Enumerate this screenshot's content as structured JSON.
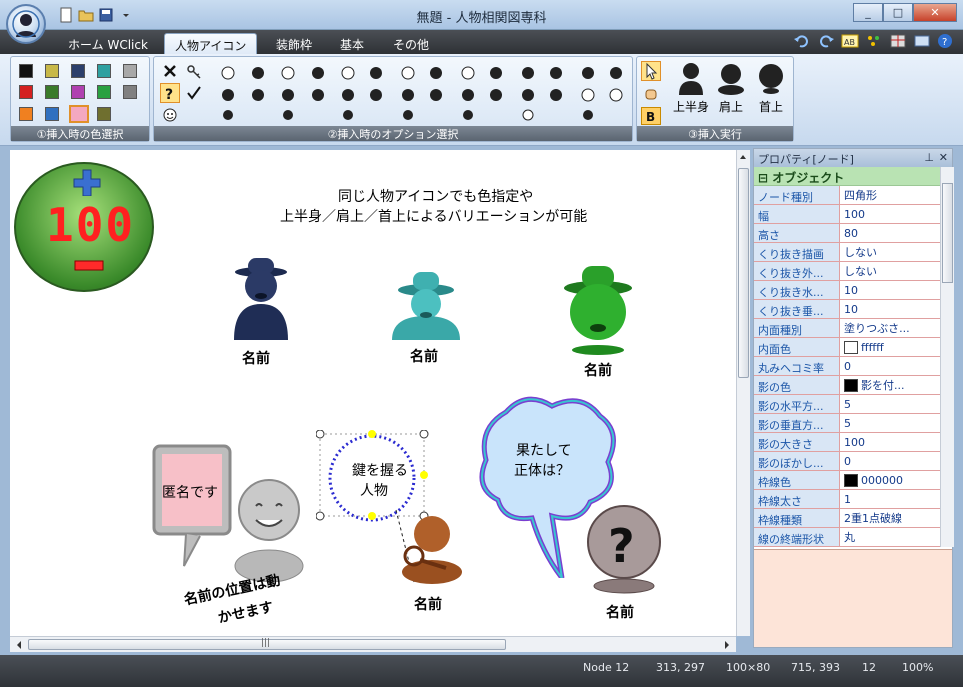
{
  "window": {
    "title": "無題 - 人物相関図専科",
    "min": "_",
    "max": "□",
    "close": "✕"
  },
  "tabs": [
    {
      "label": "ホーム WClick"
    },
    {
      "label": "人物アイコン"
    },
    {
      "label": "装飾枠"
    },
    {
      "label": "基本"
    },
    {
      "label": "その他"
    }
  ],
  "ribbon": {
    "group1_label": "①挿入時の色選択",
    "group2_label": "②挿入時のオプション選択",
    "group3_label": "③挿入実行",
    "insert_upper": "上半身",
    "insert_shoulder": "肩上",
    "insert_neck": "首上",
    "colors": [
      "#111111",
      "#c8b848",
      "#2c3f6b",
      "#2fa0a0",
      "#a8a8a8",
      "#d42020",
      "#3a7a2a",
      "#b040b0",
      "#2aa040",
      "#808080",
      "#f08020",
      "#3070c0",
      "#f4a8c0",
      "#6f6f2f"
    ]
  },
  "canvas": {
    "headline1": "同じ人物アイコンでも色指定や",
    "headline2": "上半身／肩上／首上によるバリエーションが可能",
    "counter": "100",
    "name_label": "名前",
    "speech1": "匿名です",
    "speech2_line1": "鍵を握る",
    "speech2_line2": "人物",
    "speech3_line1": "果たして",
    "speech3_line2": "正体は？",
    "move_note_line1": "名前の位置は動",
    "move_note_line2": "かせます",
    "scroll_mid": "|||"
  },
  "properties": {
    "title": "プロパティ[ノード]",
    "pin": "⊥",
    "close": "✕",
    "category": "オブジェクト",
    "rows": [
      {
        "key": "ノード種別",
        "value": "四角形"
      },
      {
        "key": "幅",
        "value": "100"
      },
      {
        "key": "高さ",
        "value": "80"
      },
      {
        "key": "くり抜き描画",
        "value": "しない"
      },
      {
        "key": "くり抜き外...",
        "value": "しない"
      },
      {
        "key": "くり抜き水...",
        "value": "10"
      },
      {
        "key": "くり抜き垂...",
        "value": "10"
      },
      {
        "key": "内面種別",
        "value": "塗りつぶさ..."
      },
      {
        "key": "内面色",
        "value": "ffffff",
        "chip": "#ffffff"
      },
      {
        "key": "丸みヘコミ率",
        "value": "0"
      },
      {
        "key": "影の色",
        "value": "影を付...",
        "chip": "#000000"
      },
      {
        "key": "影の水平方...",
        "value": "5"
      },
      {
        "key": "影の垂直方...",
        "value": "5"
      },
      {
        "key": "影の大きさ",
        "value": "100"
      },
      {
        "key": "影のぼかし...",
        "value": "0"
      },
      {
        "key": "枠線色",
        "value": "000000",
        "chip": "#000000"
      },
      {
        "key": "枠線太さ",
        "value": "1"
      },
      {
        "key": "枠線種類",
        "value": "2重1点破線"
      },
      {
        "key": "線の終端形状",
        "value": "丸"
      }
    ]
  },
  "status": {
    "node": "Node 12",
    "pos": "313, 297",
    "size": "100×80",
    "cursor": "715, 393",
    "font": "12",
    "zoom": "100%"
  },
  "palette": {
    "accent": "#2e3135",
    "ribbon": "#d6e4f4",
    "selection_dots": "#2b2bd0"
  }
}
